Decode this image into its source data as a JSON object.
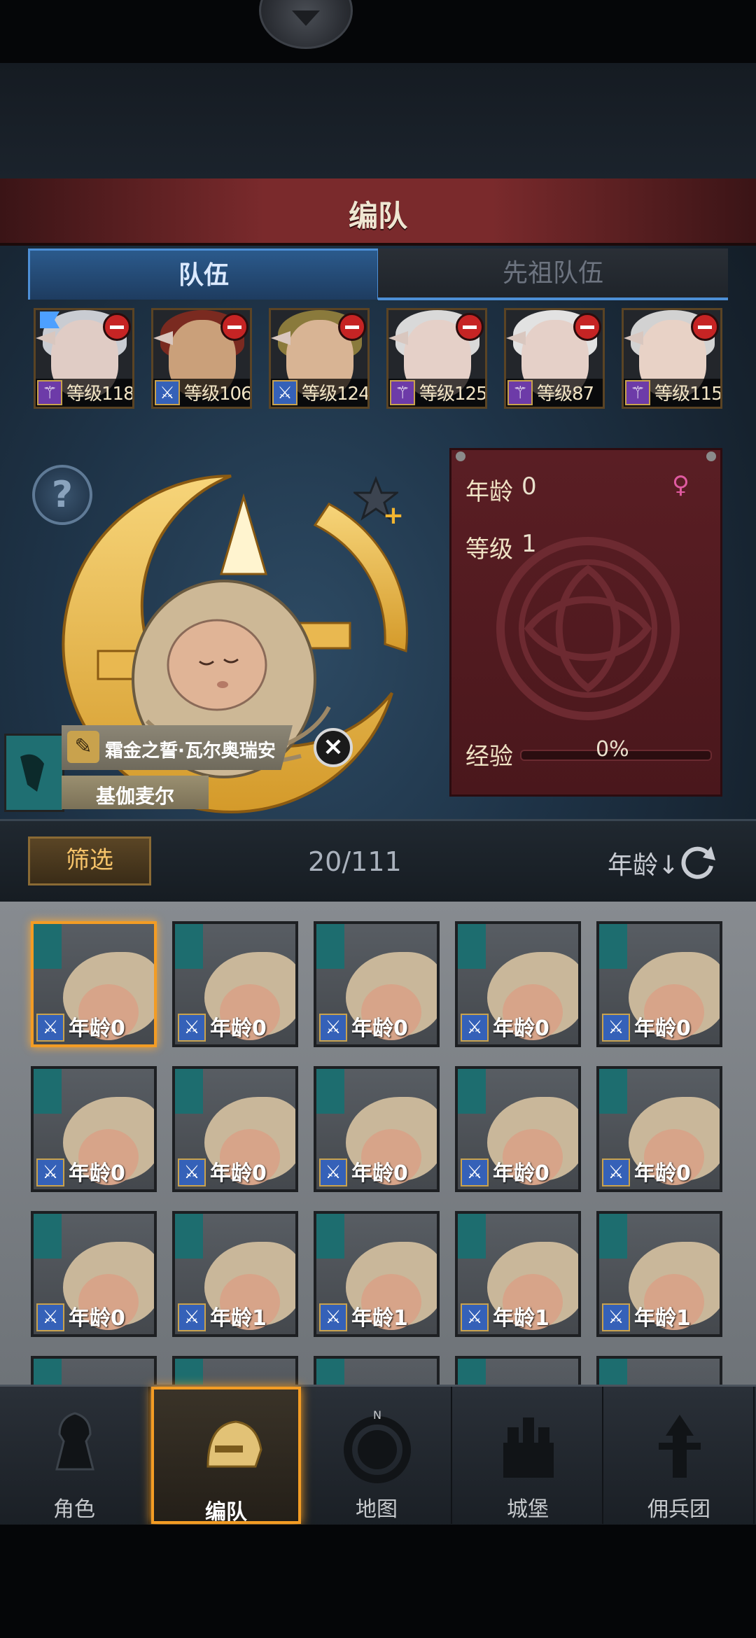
{
  "header": {
    "title": "编队"
  },
  "tabs": [
    {
      "label": "队伍",
      "active": true
    },
    {
      "label": "先祖队伍",
      "active": false
    }
  ],
  "team": [
    {
      "level": "等级118",
      "class": "staff",
      "flag": true,
      "hair": "#c9ccd2",
      "skin": "#e0ccc5"
    },
    {
      "level": "等级106",
      "class": "sword",
      "flag": false,
      "hair": "#7a2a20",
      "skin": "#caa07a"
    },
    {
      "level": "等级124",
      "class": "sword",
      "flag": false,
      "hair": "#8a7a3c",
      "skin": "#d8b494"
    },
    {
      "level": "等级125",
      "class": "staff",
      "flag": false,
      "hair": "#d9d9d9",
      "skin": "#e5d0c8"
    },
    {
      "level": "等级87",
      "class": "staff",
      "flag": false,
      "hair": "#e2e2e2",
      "skin": "#e5d0c8"
    },
    {
      "level": "等级115",
      "class": "staff",
      "flag": false,
      "hair": "#d2d2d2",
      "skin": "#e8d2c6"
    }
  ],
  "stats": {
    "age_label": "年龄",
    "age_value": "0",
    "level_label": "等级",
    "level_value": "1",
    "exp_label": "经验",
    "exp_value": "0%"
  },
  "character": {
    "name": "霜金之誓·瓦尔奥瑞安",
    "house": "基伽麦尔"
  },
  "filter": {
    "button": "筛选",
    "count": "20/111",
    "sort": "年龄↓"
  },
  "grid": [
    {
      "age": "年龄0",
      "selected": true
    },
    {
      "age": "年龄0"
    },
    {
      "age": "年龄0"
    },
    {
      "age": "年龄0"
    },
    {
      "age": "年龄0"
    },
    {
      "age": "年龄0"
    },
    {
      "age": "年龄0"
    },
    {
      "age": "年龄0"
    },
    {
      "age": "年龄0"
    },
    {
      "age": "年龄0"
    },
    {
      "age": "年龄0"
    },
    {
      "age": "年龄1"
    },
    {
      "age": "年龄1"
    },
    {
      "age": "年龄1"
    },
    {
      "age": "年龄1"
    },
    {
      "age": ""
    },
    {
      "age": ""
    },
    {
      "age": ""
    },
    {
      "age": ""
    },
    {
      "age": ""
    }
  ],
  "nav": [
    {
      "label": "角色",
      "icon": "knight-icon",
      "active": false
    },
    {
      "label": "编队",
      "icon": "helmet-icon",
      "active": true
    },
    {
      "label": "地图",
      "icon": "compass-icon",
      "active": false
    },
    {
      "label": "城堡",
      "icon": "castle-icon",
      "active": false
    },
    {
      "label": "佣兵团",
      "icon": "mercenary-icon",
      "active": false
    }
  ],
  "colors": {
    "accent": "#f39c24",
    "tab_blue": "#4d8fd6",
    "panel_red": "#5a1e24"
  }
}
